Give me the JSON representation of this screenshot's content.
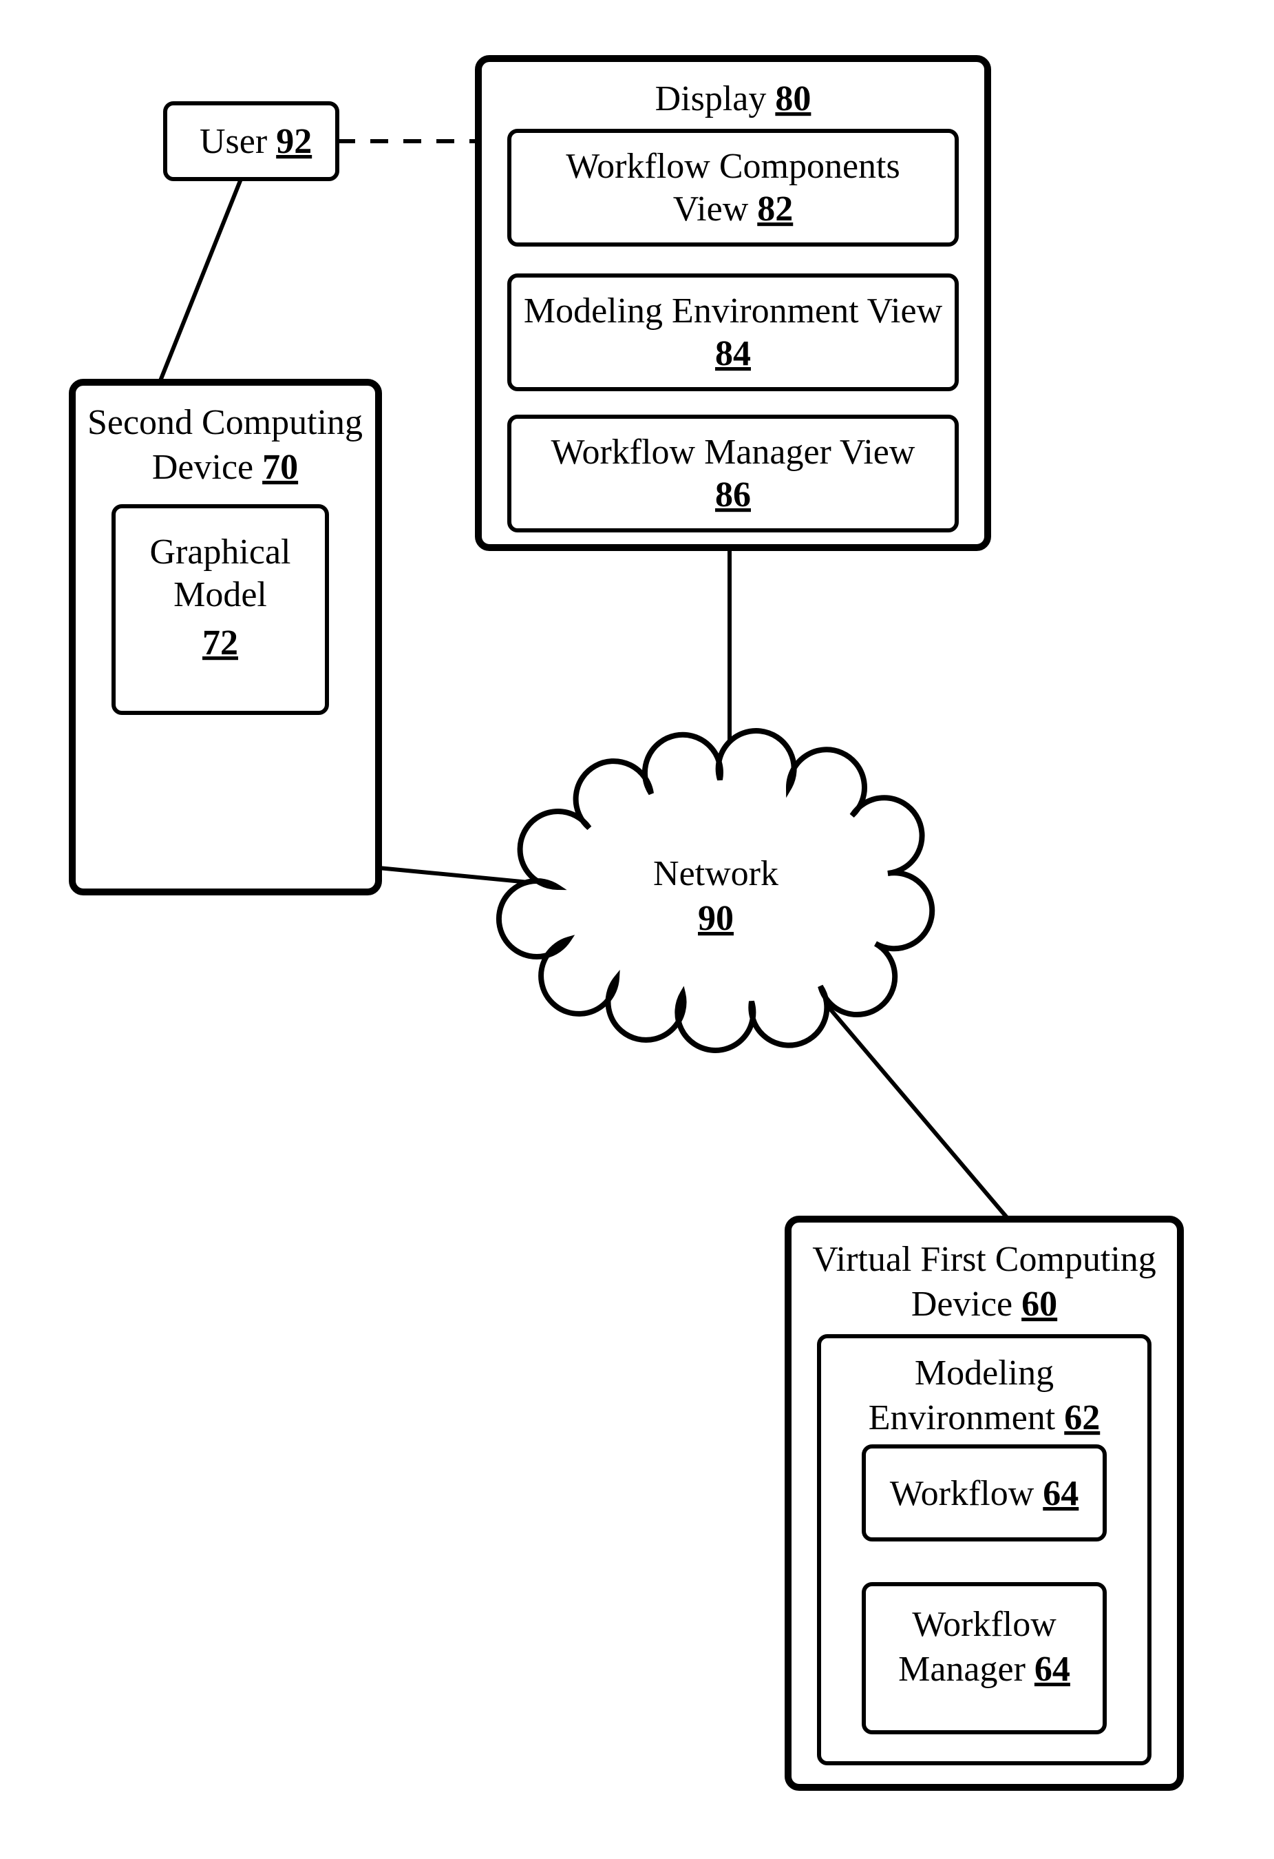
{
  "user": {
    "label": "User",
    "num": "92"
  },
  "display": {
    "title": "Display",
    "num": "80",
    "wc1": "Workflow Components",
    "wc2": "View",
    "wc_num": "82",
    "mev1": "Modeling Environment View",
    "mev_num": "84",
    "wmv1": "Workflow Manager View",
    "wmv_num": "86"
  },
  "second": {
    "line1": "Second Computing",
    "line2": "Device",
    "num": "70",
    "gm1": "Graphical",
    "gm2": "Model",
    "gm_num": "72"
  },
  "network": {
    "label": "Network",
    "num": "90"
  },
  "virtual": {
    "line1": "Virtual First Computing",
    "line2": "Device",
    "num": "60",
    "me1": "Modeling",
    "me2": "Environment",
    "me_num": "62",
    "wf": "Workflow",
    "wf_num": "64",
    "wm1": "Workflow",
    "wm2": "Manager",
    "wm_num": "64"
  }
}
